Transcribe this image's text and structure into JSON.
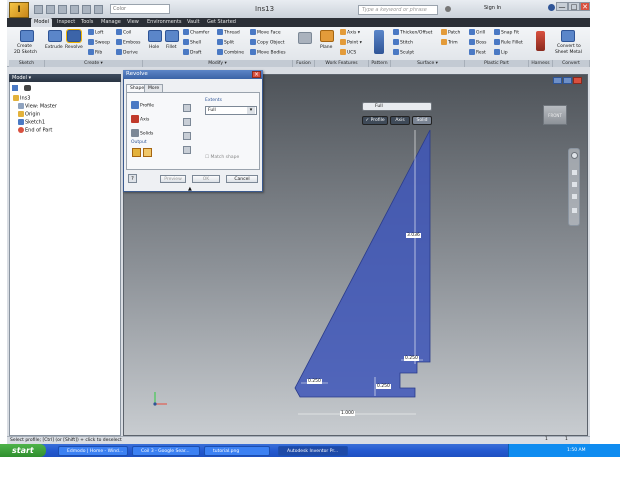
{
  "title_bar": {
    "document_title": "Ins13",
    "help_search_placeholder": "Type a keyword or phrase",
    "sign_in": "Sign In",
    "quick_access_label": "Color",
    "min_glyph": "—",
    "max_glyph": "□",
    "close_glyph": "✕"
  },
  "tabs": [
    "Model",
    "Inspect",
    "Tools",
    "Manage",
    "View",
    "Environments",
    "Vault",
    "Get Started"
  ],
  "ribbon": {
    "sketch": {
      "create": "Create",
      "create2": "2D Sketch",
      "panel": "Sketch"
    },
    "create_panel": {
      "extrude": "Extrude",
      "revolve": "Revolve",
      "loft": "Loft",
      "sweep": "Sweep",
      "rib": "Rib",
      "coil": "Coil",
      "emboss": "Emboss",
      "derive": "Derive",
      "panel": "Create ▾"
    },
    "modify_panel": {
      "hole": "Hole",
      "fillet": "Fillet",
      "chamfer": "Chamfer",
      "shell": "Shell",
      "draft": "Draft",
      "thread": "Thread",
      "split": "Split",
      "combine": "Combine",
      "move_face": "Move Face",
      "copy_object": "Copy Object",
      "move_bodies": "Move Bodies",
      "panel": "Modify ▾"
    },
    "fusion": {
      "label": "Fusion",
      "panel": "Fusion"
    },
    "work_features": {
      "plane": "Plane",
      "axis": "Axis ▾",
      "point": "Point ▾",
      "ucs": "UCS",
      "panel": "Work Features"
    },
    "pattern": {
      "panel": "Pattern"
    },
    "surface": {
      "thicken": "Thicken/Offset",
      "stitch": "Stitch",
      "sculpt": "Sculpt",
      "patch": "Patch",
      "trim": "Trim",
      "panel": "Surface ▾"
    },
    "plastic": {
      "grill": "Grill",
      "boss": "Boss",
      "rest": "Rest",
      "snap_fit": "Snap Fit",
      "rule_fillet": "Rule Fillet",
      "lip": "Lip",
      "panel": "Plastic Part"
    },
    "harness": {
      "panel": "Harness"
    },
    "convert": {
      "label": "Convert to",
      "label2": "Sheet Metal",
      "panel": "Convert"
    }
  },
  "browser": {
    "header": "Model ▾",
    "items": [
      "Ins3",
      "View: Master",
      "Origin",
      "Sketch1",
      "End of Part"
    ]
  },
  "dialog": {
    "title": "Revolve",
    "tabs": [
      "Shape",
      "More"
    ],
    "profile": "Profile",
    "axis": "Axis",
    "solids": "Solids",
    "output": "Output",
    "extents_label": "Extents",
    "extents_value": "Full",
    "match_shape": "Match shape",
    "ok": "OK",
    "cancel": "Cancel",
    "preview": "Preview"
  },
  "viewport": {
    "mini_value": "Full",
    "mini_ok": "✓ Profile",
    "mini_axis": "Axis",
    "mini_solid": "Solid",
    "view_cube": "FRONT"
  },
  "dimensions": [
    "3.036",
    "0.250",
    "0.250",
    "0.250",
    "1.000"
  ],
  "status_bar": {
    "text": "Select profile; [Ctrl] (or [Shift]) + click to deselect",
    "count1": "1",
    "count2": "1"
  },
  "taskbar": {
    "start": "start",
    "items": [
      "Edmodo | Home - Wind...",
      "Coil 3 - Google Sear...",
      "tutorial.png",
      "Autodesk Inventor Pr..."
    ],
    "clock": "1:50 AM"
  }
}
